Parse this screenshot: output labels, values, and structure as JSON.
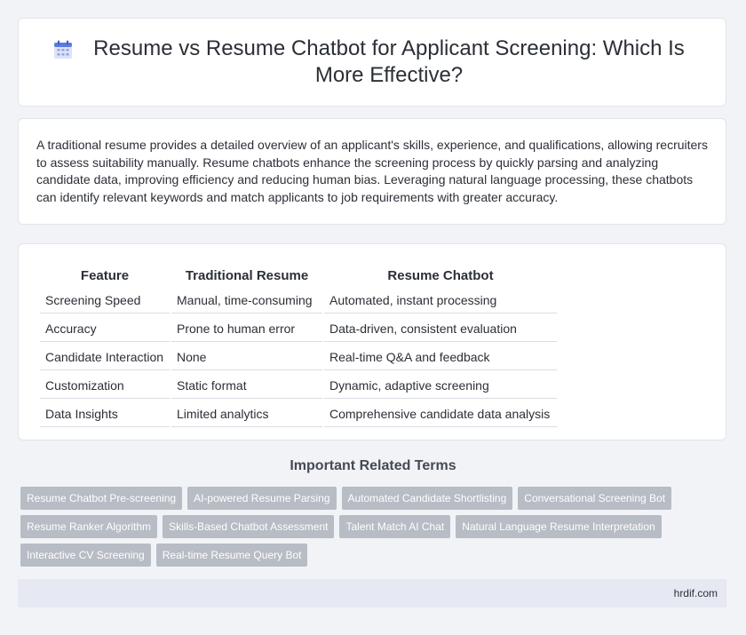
{
  "header": {
    "title": "Resume vs Resume Chatbot for Applicant Screening: Which Is More Effective?",
    "icon": "calendar-icon"
  },
  "intro": {
    "text": "A traditional resume provides a detailed overview of an applicant's skills, experience, and qualifications, allowing recruiters to assess suitability manually. Resume chatbots enhance the screening process by quickly parsing and analyzing candidate data, improving efficiency and reducing human bias. Leveraging natural language processing, these chatbots can identify relevant keywords and match applicants to job requirements with greater accuracy."
  },
  "comparison": {
    "headers": [
      "Feature",
      "Traditional Resume",
      "Resume Chatbot"
    ],
    "rows": [
      [
        "Screening Speed",
        "Manual, time-consuming",
        "Automated, instant processing"
      ],
      [
        "Accuracy",
        "Prone to human error",
        "Data-driven, consistent evaluation"
      ],
      [
        "Candidate Interaction",
        "None",
        "Real-time Q&A and feedback"
      ],
      [
        "Customization",
        "Static format",
        "Dynamic, adaptive screening"
      ],
      [
        "Data Insights",
        "Limited analytics",
        "Comprehensive candidate data analysis"
      ]
    ]
  },
  "terms": {
    "heading": "Important Related Terms",
    "items": [
      "Resume Chatbot Pre-screening",
      "AI-powered Resume Parsing",
      "Automated Candidate Shortlisting",
      "Conversational Screening Bot",
      "Resume Ranker Algorithm",
      "Skills-Based Chatbot Assessment",
      "Talent Match AI Chat",
      "Natural Language Resume Interpretation",
      "Interactive CV Screening",
      "Real-time Resume Query Bot"
    ]
  },
  "footer": {
    "site": "hrdif.com"
  },
  "colors": {
    "background": "#f1f3f7",
    "tag": "#b7bcc5",
    "icon_accent": "#5b7be0"
  }
}
